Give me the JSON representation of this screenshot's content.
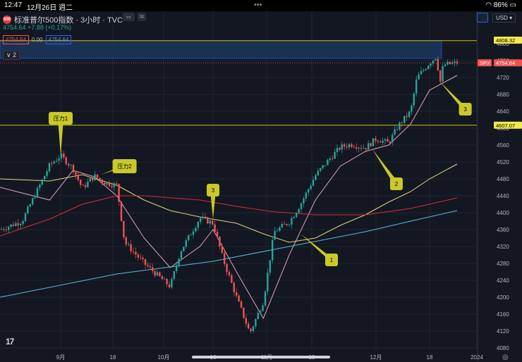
{
  "status_bar": {
    "time": "12:47",
    "date": "12月26日 週二",
    "battery": "86%"
  },
  "header": {
    "symbol_badge": "500",
    "title": "标准普尔500指数 · 3小时 · TVC",
    "last": "4754.64",
    "change": "+7.88 (+0.17%)",
    "bid": "4754.64",
    "spread": "0.00",
    "ask": "4754.64",
    "indicators_toggle": "2",
    "currency": "USD"
  },
  "chart_data": {
    "type": "candlestick",
    "symbol": "SPX",
    "ylim": [
      4080,
      4840
    ],
    "y_ticks": [
      4080,
      4120,
      4160,
      4200,
      4240,
      4280,
      4320,
      4360,
      4400,
      4440,
      4480,
      4520,
      4560,
      4600,
      4640,
      4680,
      4720,
      4760,
      4800
    ],
    "x_tick_labels": [
      "9月",
      "18",
      "10月",
      "16",
      "11月",
      "13",
      "12月",
      "18",
      "2024"
    ],
    "price_labels": {
      "last": "4754.64",
      "resistance_top": "4808.32",
      "resistance_mid": "4607.07",
      "symbol_tag": "SPX"
    },
    "horizontal_lines": [
      4807,
      4607
    ],
    "key_price_path": [
      [
        "8/21",
        4360
      ],
      [
        "8/25",
        4380
      ],
      [
        "8/30",
        4512
      ],
      [
        "9/1",
        4535
      ],
      [
        "9/5",
        4505
      ],
      [
        "9/8",
        4458
      ],
      [
        "9/12",
        4487
      ],
      [
        "9/15",
        4472
      ],
      [
        "9/19",
        4465
      ],
      [
        "9/21",
        4330
      ],
      [
        "9/26",
        4280
      ],
      [
        "10/3",
        4225
      ],
      [
        "10/6",
        4307
      ],
      [
        "10/12",
        4388
      ],
      [
        "10/16",
        4375
      ],
      [
        "10/19",
        4290
      ],
      [
        "10/23",
        4200
      ],
      [
        "10/27",
        4115
      ],
      [
        "10/31",
        4190
      ],
      [
        "11/3",
        4355
      ],
      [
        "11/7",
        4378
      ],
      [
        "11/10",
        4420
      ],
      [
        "11/14",
        4488
      ],
      [
        "11/17",
        4518
      ],
      [
        "11/21",
        4555
      ],
      [
        "11/24",
        4562
      ],
      [
        "11/28",
        4553
      ],
      [
        "12/1",
        4575
      ],
      [
        "12/5",
        4565
      ],
      [
        "12/8",
        4605
      ],
      [
        "12/12",
        4640
      ],
      [
        "12/14",
        4720
      ],
      [
        "12/18",
        4755
      ],
      [
        "12/20",
        4770
      ],
      [
        "12/21",
        4705
      ],
      [
        "12/22",
        4750
      ],
      [
        "12/26",
        4754.64
      ]
    ],
    "moving_averages": [
      {
        "name": "ma-fast-pink",
        "color": "#e8a0c8",
        "path": [
          [
            "8/21",
            4460
          ],
          [
            "8/30",
            4430
          ],
          [
            "9/5",
            4500
          ],
          [
            "9/12",
            4485
          ],
          [
            "9/19",
            4440
          ],
          [
            "9/26",
            4340
          ],
          [
            "10/3",
            4270
          ],
          [
            "10/12",
            4320
          ],
          [
            "10/16",
            4360
          ],
          [
            "10/23",
            4260
          ],
          [
            "10/31",
            4150
          ],
          [
            "11/7",
            4300
          ],
          [
            "11/14",
            4430
          ],
          [
            "11/21",
            4510
          ],
          [
            "11/28",
            4545
          ],
          [
            "12/5",
            4560
          ],
          [
            "12/12",
            4610
          ],
          [
            "12/18",
            4690
          ],
          [
            "12/26",
            4725
          ]
        ]
      },
      {
        "name": "ma-mid-yellow",
        "color": "#e6d27a",
        "path": [
          [
            "8/21",
            4480
          ],
          [
            "8/30",
            4475
          ],
          [
            "9/8",
            4490
          ],
          [
            "9/19",
            4465
          ],
          [
            "9/26",
            4430
          ],
          [
            "10/3",
            4405
          ],
          [
            "10/12",
            4390
          ],
          [
            "10/23",
            4375
          ],
          [
            "10/31",
            4350
          ],
          [
            "11/7",
            4330
          ],
          [
            "11/14",
            4340
          ],
          [
            "11/21",
            4370
          ],
          [
            "11/28",
            4395
          ],
          [
            "12/5",
            4425
          ],
          [
            "12/12",
            4450
          ],
          [
            "12/18",
            4480
          ],
          [
            "12/26",
            4515
          ]
        ]
      },
      {
        "name": "ma-slow-red",
        "color": "#d32f2f",
        "path": [
          [
            "8/21",
            4345
          ],
          [
            "8/30",
            4385
          ],
          [
            "9/8",
            4420
          ],
          [
            "9/19",
            4440
          ],
          [
            "9/26",
            4440
          ],
          [
            "10/12",
            4430
          ],
          [
            "10/23",
            4415
          ],
          [
            "11/3",
            4402
          ],
          [
            "11/14",
            4395
          ],
          [
            "11/28",
            4395
          ],
          [
            "12/12",
            4410
          ],
          [
            "12/26",
            4435
          ]
        ]
      },
      {
        "name": "ma-long-cyan",
        "color": "#4fc3d9",
        "path": [
          [
            "8/21",
            4200
          ],
          [
            "9/19",
            4255
          ],
          [
            "10/16",
            4285
          ],
          [
            "11/7",
            4320
          ],
          [
            "11/28",
            4355
          ],
          [
            "12/12",
            4380
          ],
          [
            "12/26",
            4405
          ]
        ]
      }
    ],
    "annotations": [
      {
        "text": "压力1",
        "date": "9/1",
        "price": 4535
      },
      {
        "text": "压力2",
        "date": "9/14",
        "price": 4490
      },
      {
        "text": "3",
        "date": "10/16",
        "price": 4385
      },
      {
        "text": "1",
        "date": "11/10",
        "price": 4350
      },
      {
        "text": "2",
        "date": "11/30",
        "price": 4550
      },
      {
        "text": "3",
        "date": "12/21",
        "price": 4710
      }
    ]
  }
}
